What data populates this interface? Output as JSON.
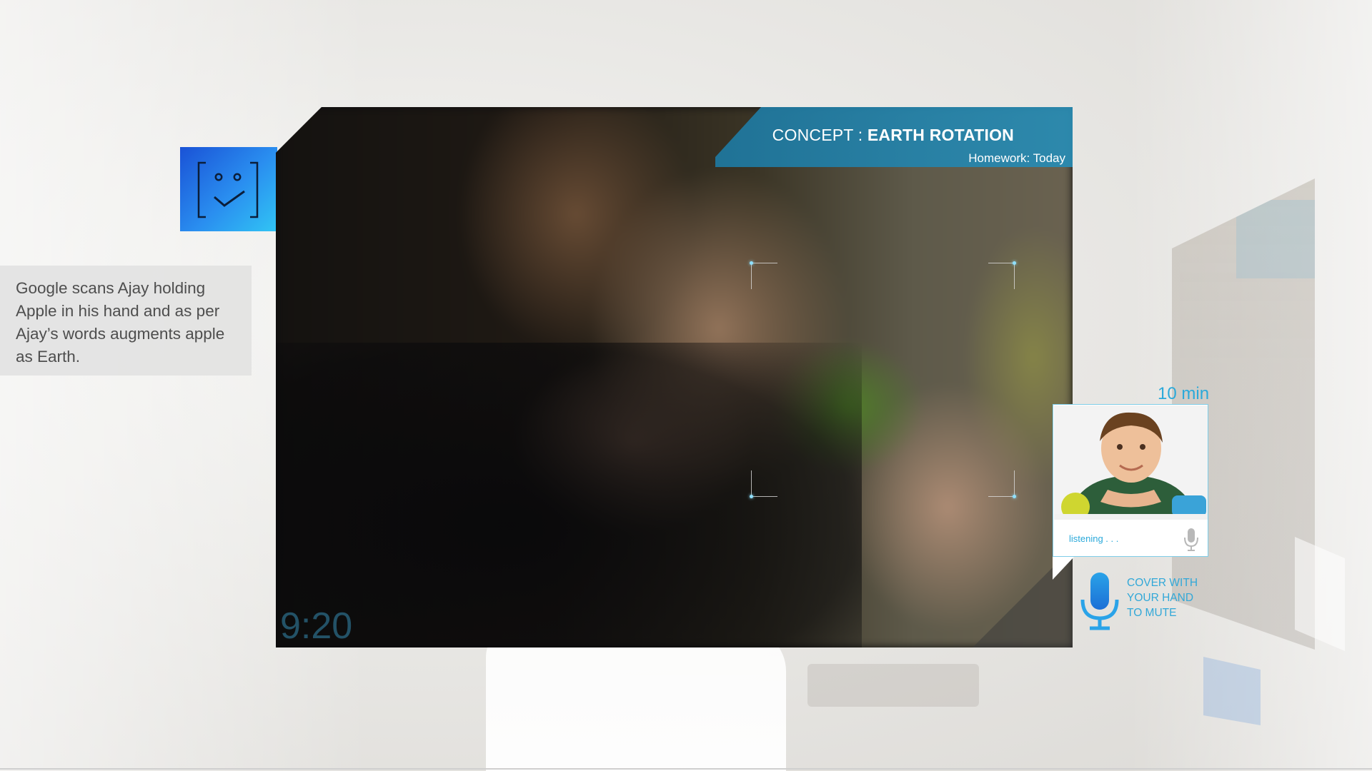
{
  "assistant": {
    "icon": "smiley-check-icon"
  },
  "caption": {
    "text": "Google scans Ajay holding Apple in his hand and as per Ajay’s words augments apple as Earth."
  },
  "video": {
    "concept_label": "CONCEPT : ",
    "concept_value": "EARTH ROTATION",
    "homework": "Homework: Today",
    "time": "9:20"
  },
  "call": {
    "time_left": "10 min",
    "status": "listening . . .",
    "mic_icon": "microphone-icon"
  },
  "mute_hint": {
    "line1": "COVER WITH",
    "line2": "YOUR HAND",
    "line3": "TO MUTE",
    "icon": "microphone-icon"
  },
  "colors": {
    "accent": "#2aa9da",
    "badge_start": "#1a52d6",
    "badge_end": "#31c5f4",
    "banner": "#1e78a0"
  }
}
